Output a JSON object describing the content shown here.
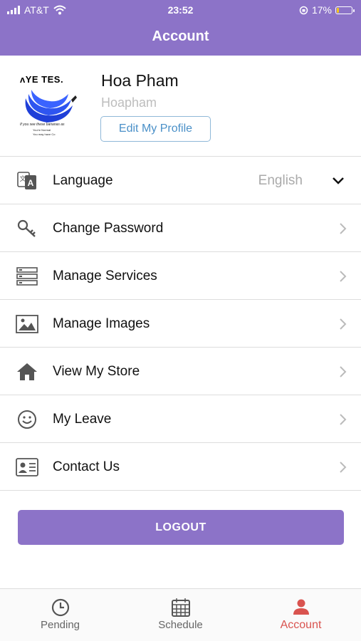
{
  "status_bar": {
    "carrier": "AT&T",
    "time": "23:52",
    "battery": "17%",
    "battery_level": 0.17
  },
  "header": {
    "title": "Account"
  },
  "profile": {
    "avatar_text_top": "ʌYE TES.",
    "avatar_text_1": "If you see these bananas as",
    "avatar_text_2": "You're Normal",
    "avatar_text_3": "You may have Co",
    "name": "Hoa Pham",
    "username": "Hoapham",
    "edit_label": "Edit My Profile"
  },
  "menu": {
    "items": [
      {
        "label": "Language",
        "value": "English",
        "icon": "translate-icon",
        "control": "chevron-down"
      },
      {
        "label": "Change Password",
        "icon": "key-icon",
        "control": "chevron-right"
      },
      {
        "label": "Manage Services",
        "icon": "server-list-icon",
        "control": "chevron-right"
      },
      {
        "label": "Manage Images",
        "icon": "image-icon",
        "control": "chevron-right"
      },
      {
        "label": "View My Store",
        "icon": "home-icon",
        "control": "chevron-right"
      },
      {
        "label": "My Leave",
        "icon": "smiley-icon",
        "control": "chevron-right"
      },
      {
        "label": "Contact Us",
        "icon": "contact-card-icon",
        "control": "chevron-right"
      }
    ]
  },
  "logout_label": "LOGOUT",
  "tabs": [
    {
      "label": "Pending",
      "icon": "clock-icon",
      "active": false
    },
    {
      "label": "Schedule",
      "icon": "calendar-icon",
      "active": false
    },
    {
      "label": "Account",
      "icon": "person-icon",
      "active": true
    }
  ],
  "colors": {
    "primary": "#8c73c8",
    "active_tab": "#d9534f",
    "link_blue": "#4a90c8",
    "muted_text": "#aaaaaa",
    "battery_fill": "#f5c518"
  }
}
